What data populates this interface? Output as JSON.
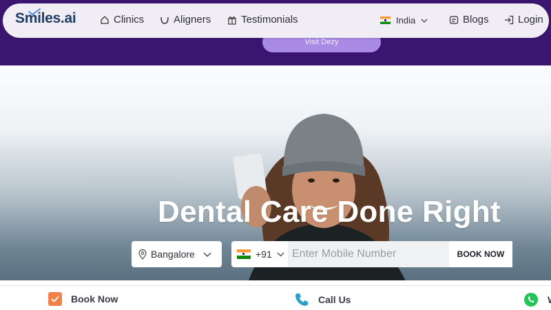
{
  "brand": {
    "name": "Smiles.ai",
    "accent": "#3a1670",
    "logo_color": "#1f3c63"
  },
  "promo": {
    "label": "Visit Dezy"
  },
  "nav": {
    "items": [
      {
        "label": "Clinics",
        "icon": "home-icon"
      },
      {
        "label": "Aligners",
        "icon": "aligner-icon"
      },
      {
        "label": "Testimonials",
        "icon": "gift-icon"
      }
    ],
    "country": "India",
    "blogs": "Blogs",
    "login": "Login"
  },
  "hero": {
    "headline": "Dental Care Done Right",
    "city": "Bangalore",
    "country_code": "+91",
    "mobile_placeholder": "Enter Mobile Number",
    "book_label": "BOOK NOW"
  },
  "bottom_bar": {
    "book": "Book Now",
    "call": "Call Us",
    "whatsapp_partial": "W"
  }
}
